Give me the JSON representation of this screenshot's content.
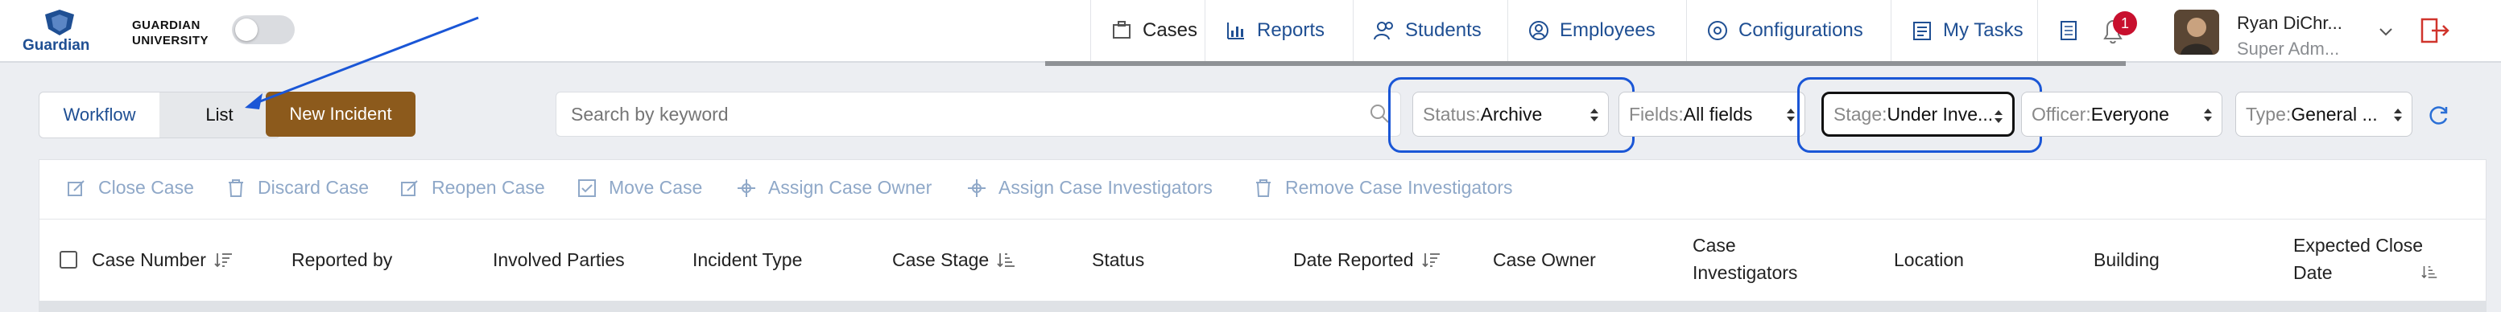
{
  "brand": {
    "logo_text": "Guardian",
    "org_line1": "Guardian",
    "org_line2": "University"
  },
  "nav": {
    "items": [
      {
        "label": "Cases",
        "icon": "cases-icon"
      },
      {
        "label": "Reports",
        "icon": "reports-icon"
      },
      {
        "label": "Students",
        "icon": "students-icon"
      },
      {
        "label": "Employees",
        "icon": "employees-icon"
      },
      {
        "label": "Configurations",
        "icon": "configurations-icon"
      },
      {
        "label": "My Tasks",
        "icon": "tasks-icon"
      }
    ],
    "notification_count": "1"
  },
  "user": {
    "name": "Ryan DiChr...",
    "role": "Super Adm..."
  },
  "view_toggle": {
    "workflow": "Workflow",
    "list": "List",
    "selected": "List"
  },
  "new_incident_label": "New Incident",
  "search": {
    "placeholder": "Search by keyword",
    "value": ""
  },
  "filters": {
    "status": {
      "label": "Status:",
      "value": "Archive"
    },
    "fields": {
      "label": "Fields:",
      "value": "All fields"
    },
    "stage": {
      "label": "Stage:",
      "value": "Under Inve..."
    },
    "officer": {
      "label": "Officer:",
      "value": "Everyone"
    },
    "type": {
      "label": "Type:",
      "value": "General ..."
    }
  },
  "actions": [
    "Close Case",
    "Discard Case",
    "Reopen Case",
    "Move Case",
    "Assign Case Owner",
    "Assign Case Investigators",
    "Remove Case Investigators"
  ],
  "columns": [
    "Case Number",
    "Reported by",
    "Involved Parties",
    "Incident Type",
    "Case Stage",
    "Status",
    "Date Reported",
    "Case Owner",
    "Case Investigators",
    "Location",
    "Building",
    "Expected Close Date"
  ],
  "colors": {
    "accent": "#1f4f93",
    "brand_button": "#8c5a1c",
    "highlight": "#1a56d6",
    "badge": "#c8102e"
  }
}
